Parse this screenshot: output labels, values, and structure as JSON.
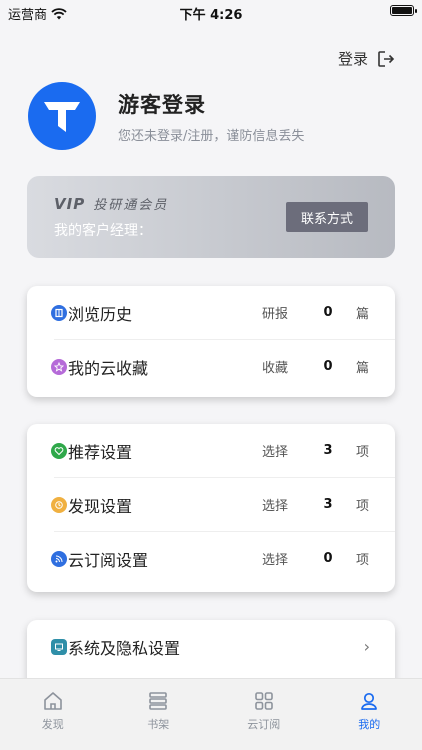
{
  "status_bar": {
    "carrier": "运营商",
    "time": "下午 4:26"
  },
  "header": {
    "login_label": "登录"
  },
  "profile": {
    "title": "游客登录",
    "subtitle": "您还未登录/注册，谨防信息丢失"
  },
  "vip": {
    "mark": "VIP",
    "name": "投研通会员",
    "manager_label": "我的客户经理：",
    "contact_button": "联系方式"
  },
  "history_section": {
    "rows": [
      {
        "label": "浏览历史",
        "kind": "研报",
        "count": "0",
        "unit": "篇",
        "icon": "book-icon",
        "color": "#2f6fe0"
      },
      {
        "label": "我的云收藏",
        "kind": "收藏",
        "count": "0",
        "unit": "篇",
        "icon": "star-icon",
        "color": "#b56ad8"
      }
    ]
  },
  "settings_section": {
    "rows": [
      {
        "label": "推荐设置",
        "kind": "选择",
        "count": "3",
        "unit": "项",
        "icon": "heart-icon",
        "color": "#2fa84a"
      },
      {
        "label": "发现设置",
        "kind": "选择",
        "count": "3",
        "unit": "项",
        "icon": "clock-icon",
        "color": "#f0b040"
      },
      {
        "label": "云订阅设置",
        "kind": "选择",
        "count": "0",
        "unit": "项",
        "icon": "rss-icon",
        "color": "#2f6fe0"
      }
    ]
  },
  "system_section": {
    "label": "系统及隐私设置",
    "icon": "system-icon",
    "arrow": "›"
  },
  "tab_bar": {
    "tabs": [
      {
        "label": "发现"
      },
      {
        "label": "书架"
      },
      {
        "label": "云订阅"
      },
      {
        "label": "我的"
      }
    ],
    "active_color": "#1a6bf0",
    "inactive_color": "#8d939c"
  }
}
